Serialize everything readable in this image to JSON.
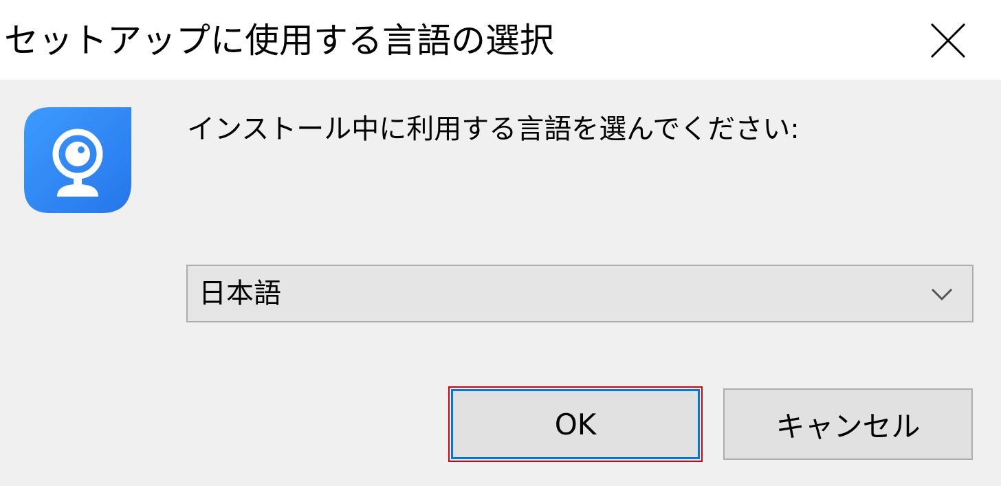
{
  "window": {
    "title": "セットアップに使用する言語の選択",
    "close_icon": "close-icon"
  },
  "app": {
    "icon": "webcam-app-icon",
    "brand_color": "#2f8af5"
  },
  "prompt": {
    "text": "インストール中に利用する言語を選んでください:"
  },
  "language_select": {
    "selected": "日本語",
    "chevron_icon": "chevron-down-icon"
  },
  "buttons": {
    "ok_label": "OK",
    "cancel_label": "キャンセル"
  },
  "colors": {
    "focus_highlight": "#0078d7",
    "annotation_outline": "#d4001a"
  }
}
